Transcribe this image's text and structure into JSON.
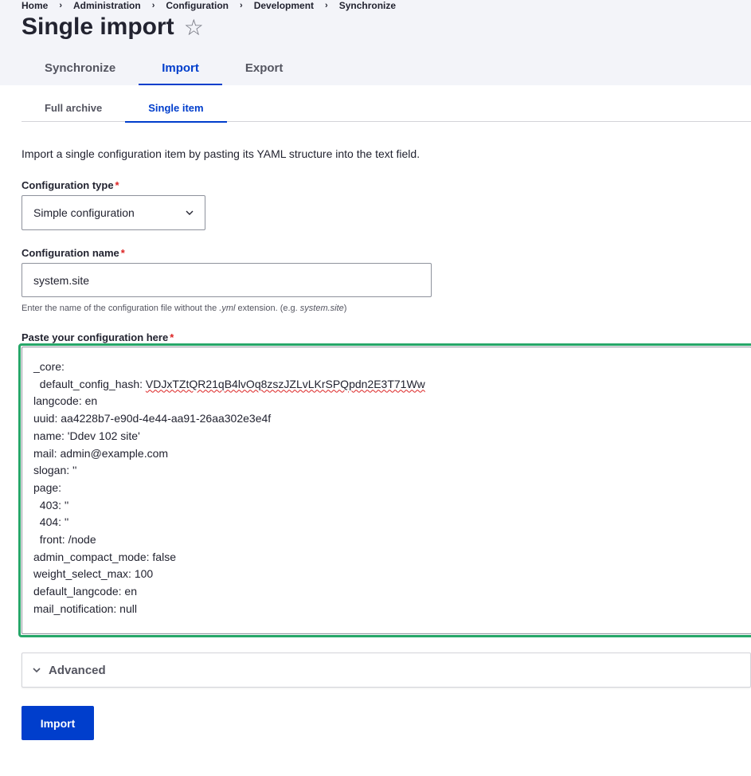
{
  "breadcrumb": [
    "Home",
    "Administration",
    "Configuration",
    "Development",
    "Synchronize"
  ],
  "page_title": "Single import",
  "primary_tabs": [
    {
      "label": "Synchronize",
      "active": false
    },
    {
      "label": "Import",
      "active": true
    },
    {
      "label": "Export",
      "active": false
    }
  ],
  "secondary_tabs": [
    {
      "label": "Full archive",
      "active": false
    },
    {
      "label": "Single item",
      "active": true
    }
  ],
  "intro": "Import a single configuration item by pasting its YAML structure into the text field.",
  "config_type": {
    "label": "Configuration type",
    "required_mark": "*",
    "selected": "Simple configuration"
  },
  "config_name": {
    "label": "Configuration name",
    "required_mark": "*",
    "value": "system.site",
    "description_before": "Enter the name of the configuration file without the ",
    "description_ext": ".yml",
    "description_mid": " extension. (e.g. ",
    "description_example": "system.site",
    "description_after": ")"
  },
  "paste_config": {
    "label": "Paste your configuration here",
    "required_mark": "*",
    "lines": [
      "_core:",
      "  default_config_hash: VDJxTZtQR21qB4lvOq8zszJZLvLKrSPQpdn2E3T71Ww",
      "langcode: en",
      "uuid: aa4228b7-e90d-4e44-aa91-26aa302e3e4f",
      "name: 'Ddev 102 site'",
      "mail: admin@example.com",
      "slogan: ''",
      "page:",
      "  403: ''",
      "  404: ''",
      "  front: /node",
      "admin_compact_mode: false",
      "weight_select_max: 100",
      "default_langcode: en",
      "mail_notification: null"
    ]
  },
  "advanced_label": "Advanced",
  "import_button": "Import",
  "colors": {
    "accent": "#003ecc",
    "focus_green": "#26a769",
    "required_red": "#dc2323",
    "header_bg": "#f3f4f9"
  }
}
